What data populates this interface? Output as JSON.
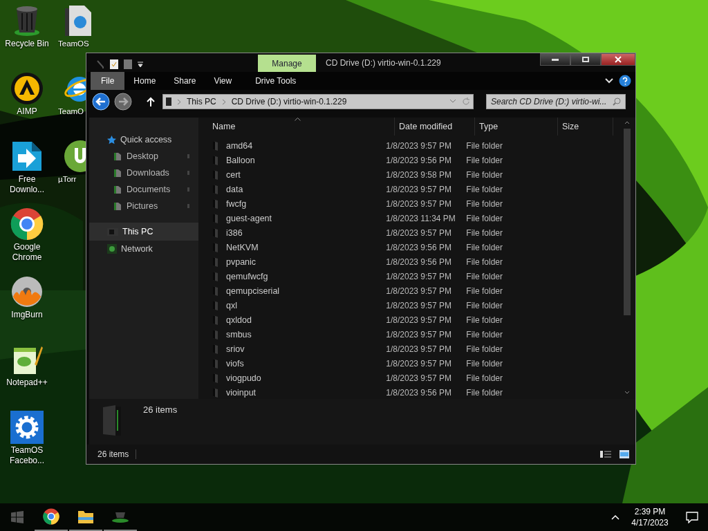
{
  "desktop_icons": [
    {
      "label": "Recycle Bin",
      "kind": "trash"
    },
    {
      "label": "AIMP",
      "kind": "player"
    },
    {
      "label": "Free Downlo...",
      "kind": "download"
    },
    {
      "label": "Google Chrome",
      "kind": "chrome"
    },
    {
      "label": "ImgBurn",
      "kind": "disc"
    },
    {
      "label": "Notepad++",
      "kind": "notepad"
    },
    {
      "label": "TeamOS Facebo...",
      "kind": "gear"
    },
    {
      "label": "TeamOS",
      "kind": "document"
    },
    {
      "label": "TeamO",
      "kind": "browser"
    },
    {
      "label": "µTorr",
      "kind": "torrent"
    }
  ],
  "window": {
    "title": "CD Drive (D:) virtio-win-0.1.229",
    "contextual_tab": "Manage",
    "ribbon_tabs": [
      {
        "label": "File",
        "selected": true
      },
      {
        "label": "Home",
        "selected": false
      },
      {
        "label": "Share",
        "selected": false
      },
      {
        "label": "View",
        "selected": false
      },
      {
        "label": "Drive Tools",
        "selected": false
      }
    ],
    "breadcrumbs": [
      "This PC",
      "CD Drive (D:) virtio-win-0.1.229"
    ],
    "search": {
      "placeholder": "Search CD Drive (D:) virtio-wi..."
    },
    "nav_pane": [
      {
        "label": "Quick access",
        "selected": false,
        "children": [
          {
            "label": "Desktop",
            "selected": false
          },
          {
            "label": "Downloads",
            "selected": false
          },
          {
            "label": "Documents",
            "selected": false
          },
          {
            "label": "Pictures",
            "selected": false
          }
        ]
      },
      {
        "label": "This PC",
        "selected": true
      },
      {
        "label": "Network",
        "selected": false
      }
    ],
    "columns": [
      "Name",
      "Date modified",
      "Type",
      "Size"
    ],
    "rows": [
      {
        "name": "amd64",
        "date": "1/8/2023 9:57 PM",
        "type": "File folder"
      },
      {
        "name": "Balloon",
        "date": "1/8/2023 9:56 PM",
        "type": "File folder"
      },
      {
        "name": "cert",
        "date": "1/8/2023 9:58 PM",
        "type": "File folder"
      },
      {
        "name": "data",
        "date": "1/8/2023 9:57 PM",
        "type": "File folder"
      },
      {
        "name": "fwcfg",
        "date": "1/8/2023 9:57 PM",
        "type": "File folder"
      },
      {
        "name": "guest-agent",
        "date": "1/8/2023 11:34 PM",
        "type": "File folder"
      },
      {
        "name": "i386",
        "date": "1/8/2023 9:57 PM",
        "type": "File folder"
      },
      {
        "name": "NetKVM",
        "date": "1/8/2023 9:56 PM",
        "type": "File folder"
      },
      {
        "name": "pvpanic",
        "date": "1/8/2023 9:56 PM",
        "type": "File folder"
      },
      {
        "name": "qemufwcfg",
        "date": "1/8/2023 9:57 PM",
        "type": "File folder"
      },
      {
        "name": "qemupciserial",
        "date": "1/8/2023 9:57 PM",
        "type": "File folder"
      },
      {
        "name": "qxl",
        "date": "1/8/2023 9:57 PM",
        "type": "File folder"
      },
      {
        "name": "qxldod",
        "date": "1/8/2023 9:57 PM",
        "type": "File folder"
      },
      {
        "name": "smbus",
        "date": "1/8/2023 9:57 PM",
        "type": "File folder"
      },
      {
        "name": "sriov",
        "date": "1/8/2023 9:57 PM",
        "type": "File folder"
      },
      {
        "name": "viofs",
        "date": "1/8/2023 9:57 PM",
        "type": "File folder"
      },
      {
        "name": "viogpudo",
        "date": "1/8/2023 9:57 PM",
        "type": "File folder"
      },
      {
        "name": "vioinput",
        "date": "1/8/2023 9:56 PM",
        "type": "File folder"
      }
    ],
    "details_pane": "26 items",
    "status_bar": "26 items"
  },
  "taskbar": {
    "apps": [
      {
        "kind": "chrome"
      },
      {
        "kind": "folder"
      },
      {
        "kind": "drive"
      }
    ],
    "time": "2:39 PM",
    "date": "4/17/2023"
  }
}
